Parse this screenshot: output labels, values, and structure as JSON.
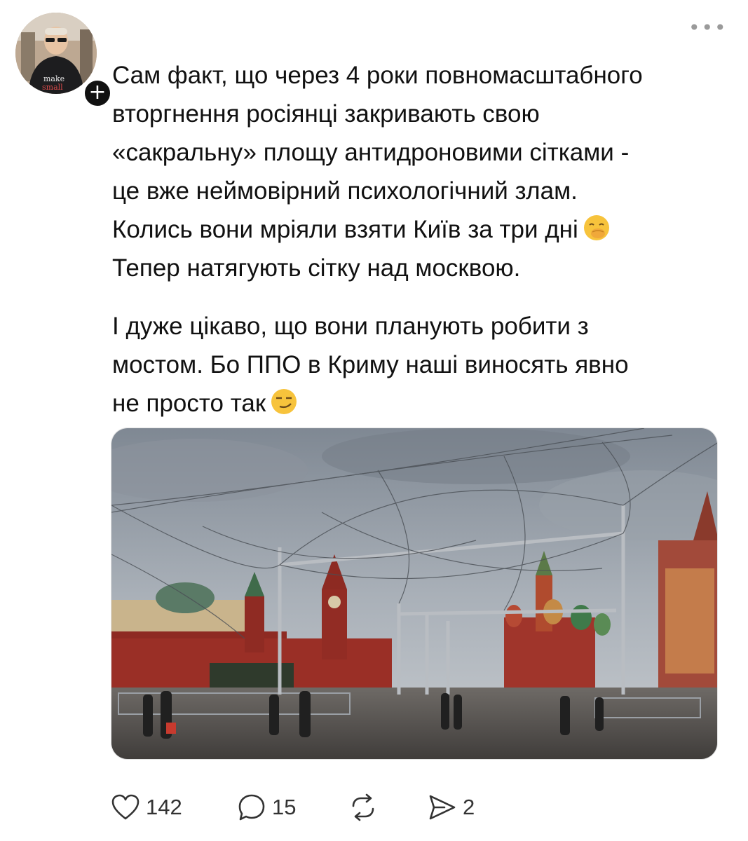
{
  "post": {
    "more_label": "•••",
    "follow_label": "+",
    "paragraphs": [
      [
        "Сам факт, що через 4 роки повномасштабного",
        "вторгнення росіянці закривають свою",
        "«сакральну» площу антидроновими сітками -",
        "це вже неймовірний психологічний злам.",
        "Колись вони мріяли взяти Київ за три дні",
        "Тепер натягують сітку над москвою."
      ],
      [
        "І дуже цікаво, що вони планують робити з",
        "мостом. Бо ППО в Криму наші виносять явно",
        "не просто так"
      ]
    ],
    "emojis": {
      "first": "face-with-hand-over-mouth",
      "second": "smirking-face"
    }
  },
  "actions": {
    "like": {
      "icon": "heart-icon",
      "count": "142"
    },
    "reply": {
      "icon": "comment-icon",
      "count": "15"
    },
    "repost": {
      "icon": "repost-icon",
      "count": ""
    },
    "share": {
      "icon": "share-icon",
      "count": "2"
    }
  },
  "colors": {
    "text": "#111111",
    "muted": "#9a9a9a",
    "emoji": "#f7c33c"
  }
}
